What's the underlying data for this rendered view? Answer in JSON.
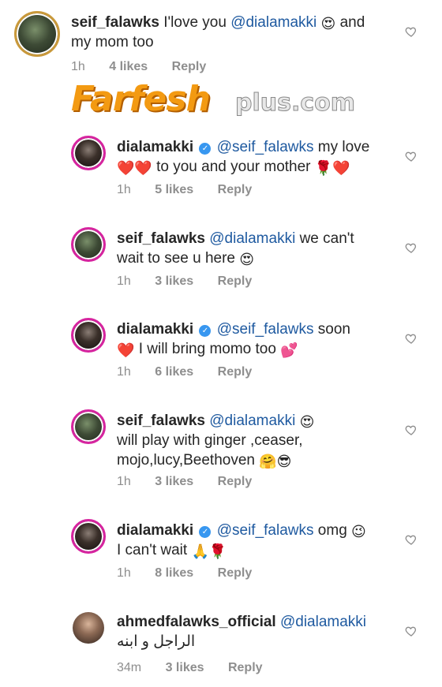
{
  "comments": [
    {
      "user": "seif_falawks",
      "parts": [
        "I'love you ",
        "@dialamakki",
        " and",
        "my mom too"
      ],
      "emoji": "😍",
      "time": "1h",
      "likes": "4 likes",
      "reply": "Reply"
    },
    {
      "user": "dialamakki",
      "parts": [
        "@seif_falawks",
        " my love",
        " to you and your mother "
      ],
      "emoji1": "❤️❤️",
      "emoji2": "🌹❤️",
      "time": "1h",
      "likes": "5 likes",
      "reply": "Reply"
    },
    {
      "user": "seif_falawks",
      "parts": [
        "@dialamakki",
        " we can't",
        "wait to see u here "
      ],
      "emoji": "😍",
      "time": "1h",
      "likes": "3 likes",
      "reply": "Reply"
    },
    {
      "user": "dialamakki",
      "parts": [
        "@seif_falawks",
        " soon",
        " I will bring momo too "
      ],
      "emoji1": "❤️",
      "emoji2": "💕",
      "time": "1h",
      "likes": "6 likes",
      "reply": "Reply"
    },
    {
      "user": "seif_falawks",
      "parts": [
        "@dialamakki",
        "will play with ginger ,ceaser,",
        "mojo,lucy,Beethoven "
      ],
      "emoji1": "😍",
      "emoji2": "🤗😎",
      "time": "1h",
      "likes": "3 likes",
      "reply": "Reply"
    },
    {
      "user": "dialamakki",
      "parts": [
        "@seif_falawks",
        " omg ",
        "I can't wait "
      ],
      "emoji1": "😉",
      "emoji2": "🙏🌹",
      "time": "1h",
      "likes": "8 likes",
      "reply": "Reply"
    },
    {
      "user": "ahmedfalawks_official",
      "parts": [
        "@dialamakki",
        "الراجل و ابنه"
      ],
      "time": "34m",
      "likes": "3 likes",
      "reply": "Reply"
    }
  ],
  "watermark": {
    "main": "Farfesh",
    "sub": "plus.com"
  },
  "colors": {
    "mention": "#1f5aa0",
    "verified": "#3897f0",
    "meta": "#8e8e8e"
  }
}
